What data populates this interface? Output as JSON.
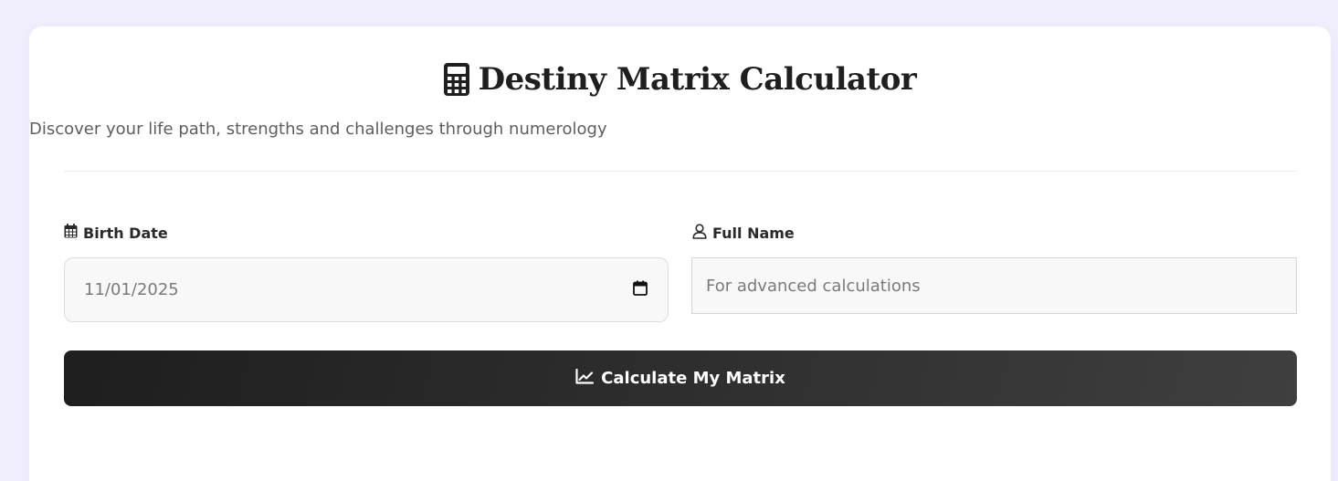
{
  "header": {
    "title": "Destiny Matrix Calculator",
    "title_icon": "calculator-icon",
    "subtitle": "Discover your life path, strengths and challenges through numerology"
  },
  "form": {
    "birth_date": {
      "label": "Birth Date",
      "icon": "calendar-icon",
      "value": "11/01/2025",
      "picker_icon": "calendar-picker-icon"
    },
    "full_name": {
      "label": "Full Name",
      "icon": "user-icon",
      "value": "",
      "placeholder": "For advanced calculations"
    },
    "submit": {
      "label": "Calculate My Matrix",
      "icon": "chart-line-icon"
    }
  },
  "colors": {
    "page_background": "#f0eefd",
    "card_background": "#ffffff",
    "button_gradient_start": "#1e1e1e",
    "button_gradient_end": "#3f3f3f",
    "text_primary": "#1f1f1f",
    "text_secondary": "#5e5e5e"
  }
}
